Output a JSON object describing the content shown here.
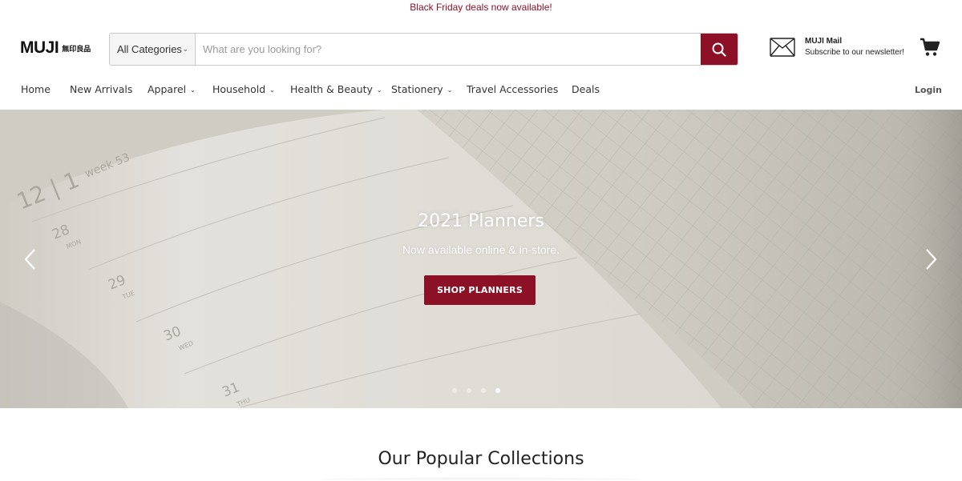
{
  "announcement": {
    "text": "Black Friday deals now available!"
  },
  "header": {
    "logo": {
      "wordmark": "MUJI",
      "kanji": "無印良品"
    },
    "search": {
      "category": "All Categories",
      "placeholder": "What are you looking for?",
      "value": ""
    },
    "newsletter": {
      "title": "MUJI Mail",
      "subtitle": "Subscribe to our newsletter!"
    }
  },
  "nav": {
    "items": [
      {
        "label": "Home"
      },
      {
        "label": "New Arrivals"
      },
      {
        "label": "Apparel"
      },
      {
        "label": "Household"
      },
      {
        "label": "Health & Beauty"
      },
      {
        "label": "Stationery"
      },
      {
        "label": "Travel Accessories"
      },
      {
        "label": "Deals"
      }
    ],
    "login": "Login"
  },
  "hero": {
    "title": "2021 Planners",
    "subtitle": "Now available online & in-store.",
    "cta": "SHOP PLANNERS",
    "slides": 4,
    "active_slide": 4,
    "planner_page": {
      "date": "12 | 1",
      "week": "week 53",
      "days": [
        {
          "num": "28",
          "day": "MON"
        },
        {
          "num": "29",
          "day": "TUE"
        },
        {
          "num": "30",
          "day": "WED"
        },
        {
          "num": "31",
          "day": "THU"
        }
      ]
    }
  },
  "sections": {
    "popular_title": "Our Popular Collections"
  },
  "colors": {
    "accent": "#8c1127",
    "text": "#333333",
    "hero_bg": "#d9d7d0"
  },
  "icons": {
    "search": "search-icon",
    "mail": "mail-icon",
    "cart": "cart-icon",
    "prev": "chevron-left-icon",
    "next": "chevron-right-icon"
  }
}
